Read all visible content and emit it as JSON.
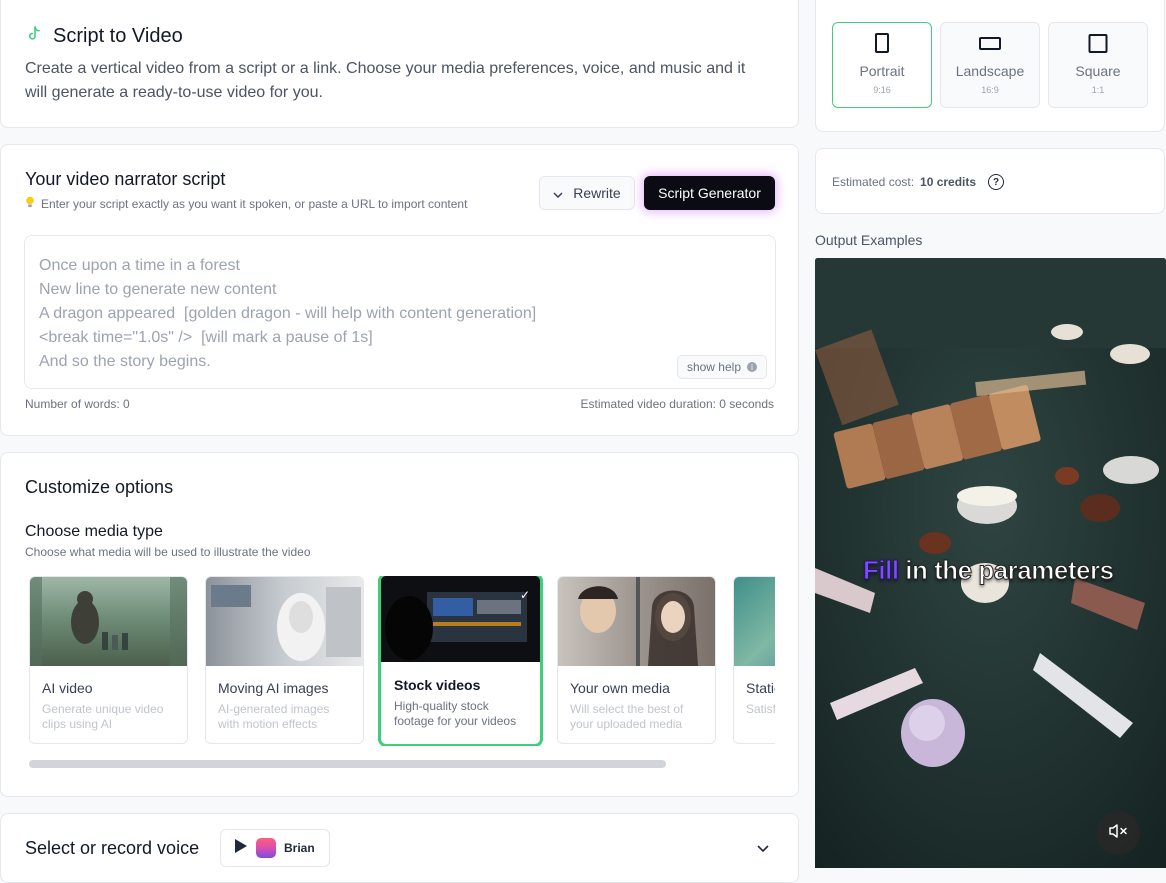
{
  "header": {
    "title": "Script to Video",
    "description": "Create a vertical video from a script or a link. Choose your media preferences, voice, and music and it will generate a ready-to-use video for you."
  },
  "script": {
    "title": "Your video narrator script",
    "hint": "Enter your script exactly as you want it spoken, or paste a URL to import content",
    "rewrite_label": "Rewrite",
    "generator_label": "Script Generator",
    "placeholder": "Once upon a time in a forest\nNew line to generate new content\nA dragon appeared  [golden dragon - will help with content generation]\n<break time=\"1.0s\" />  [will mark a pause of 1s]\nAnd so the story begins.",
    "show_help_label": "show help",
    "word_count": "Number of words: 0",
    "duration": "Estimated video duration: 0 seconds"
  },
  "customize": {
    "title": "Customize options",
    "media_title": "Choose media type",
    "media_subtitle": "Choose what media will be used to illustrate the video",
    "tiles": [
      {
        "name": "AI video",
        "desc": "Generate unique video clips using AI",
        "selected": false
      },
      {
        "name": "Moving AI images",
        "desc": "AI-generated images with motion effects",
        "selected": false
      },
      {
        "name": "Stock videos",
        "desc": "High-quality stock footage for your videos",
        "selected": true
      },
      {
        "name": "Your own media",
        "desc": "Will select the best of your uploaded media",
        "selected": false
      },
      {
        "name": "Static",
        "desc": "Satisfying grab",
        "selected": false
      }
    ]
  },
  "voice": {
    "title": "Select or record voice",
    "voice_name": "Brian"
  },
  "aspect": {
    "options": [
      {
        "label": "Portrait",
        "ratio": "9:16",
        "selected": true
      },
      {
        "label": "Landscape",
        "ratio": "16:9",
        "selected": false
      },
      {
        "label": "Square",
        "ratio": "1:1",
        "selected": false
      }
    ]
  },
  "cost": {
    "label": "Estimated cost:",
    "value": "10 credits"
  },
  "examples": {
    "title": "Output Examples",
    "caption_highlight": "Fill",
    "caption_rest": " in the parameters"
  },
  "colors": {
    "accent_green": "#3fcf7c",
    "caption_purple": "#7c4dff",
    "generator_bg": "#0b0b14"
  }
}
